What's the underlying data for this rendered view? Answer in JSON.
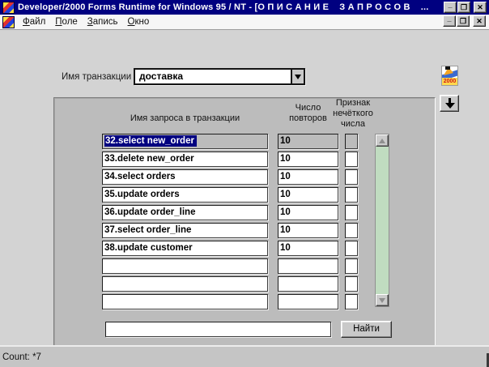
{
  "colors": {
    "titlebar_bg": "#000080",
    "selection_bg": "#000080",
    "scroll_track_green": "#c0dcc0",
    "panel_bg": "#bcbcbc"
  },
  "titlebar": {
    "title": "Developer/2000 Forms Runtime for Windows 95 / NT - [О П И С А Н И Е    З А П Р О С О В    ...",
    "minimize": "_",
    "restore": "❐",
    "close": "✕"
  },
  "menubar": {
    "items": [
      {
        "accel": "Ф",
        "rest": "айл"
      },
      {
        "accel": "П",
        "rest": "оле"
      },
      {
        "accel": "З",
        "rest": "апись"
      },
      {
        "accel": "О",
        "rest": "кно"
      }
    ],
    "minimize": "_",
    "restore": "❐",
    "close": "✕"
  },
  "toolbar": {
    "transaction_label": "Имя транзакции",
    "transaction_value": "доставка",
    "logo_text": "2000"
  },
  "panel": {
    "header_query_name": "Имя запроса в транзакции",
    "header_repeats_line1": "Число",
    "header_repeats_line2": "повторов",
    "header_fuzzy_line1": "Признак",
    "header_fuzzy_line2": "нечёткого",
    "header_fuzzy_line3": "числа",
    "rows": [
      {
        "name": "32.select new_order",
        "repeats": "10",
        "fuzzy": "",
        "selected": true
      },
      {
        "name": "33.delete new_order",
        "repeats": "10",
        "fuzzy": ""
      },
      {
        "name": "34.select orders",
        "repeats": "10",
        "fuzzy": ""
      },
      {
        "name": "35.update orders",
        "repeats": "10",
        "fuzzy": ""
      },
      {
        "name": "36.update order_line",
        "repeats": "10",
        "fuzzy": ""
      },
      {
        "name": "37.select order_line",
        "repeats": "10",
        "fuzzy": ""
      },
      {
        "name": "38.update customer",
        "repeats": "10",
        "fuzzy": ""
      },
      {
        "name": "",
        "repeats": "",
        "fuzzy": ""
      },
      {
        "name": "",
        "repeats": "",
        "fuzzy": ""
      },
      {
        "name": "",
        "repeats": "",
        "fuzzy": ""
      }
    ],
    "search_value": "",
    "find_button": "Найти"
  },
  "statusbar": {
    "text": "Count: *7"
  }
}
